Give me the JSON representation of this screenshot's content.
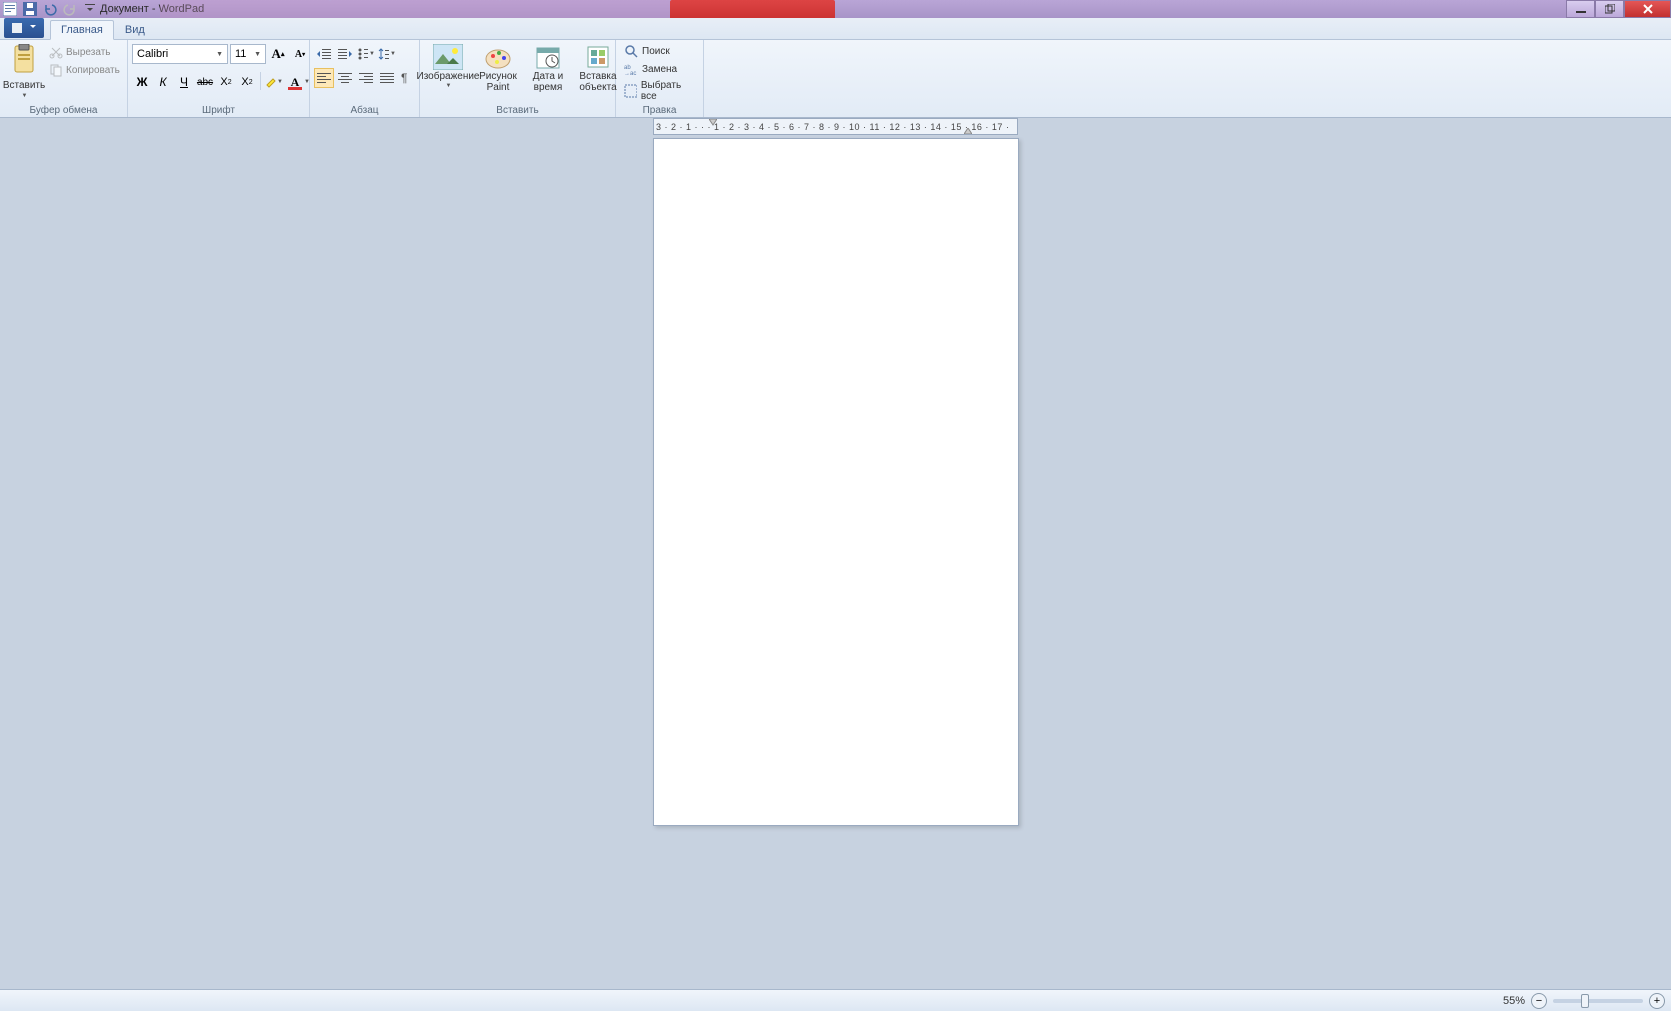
{
  "title": "Документ - WordPad",
  "tabs": {
    "main": "Главная",
    "view": "Вид"
  },
  "clipboard": {
    "paste": "Вставить",
    "cut": "Вырезать",
    "copy": "Копировать",
    "group": "Буфер обмена"
  },
  "font": {
    "family": "Calibri",
    "size": "11",
    "group": "Шрифт",
    "bold": "Ж",
    "italic": "К",
    "underline": "Ч",
    "strike": "abc"
  },
  "paragraph": {
    "group": "Абзац"
  },
  "insert": {
    "image": "Изображение",
    "paint": "Рисунок Paint",
    "datetime": "Дата и время",
    "object": "Вставка объекта",
    "group": "Вставить"
  },
  "edit": {
    "find": "Поиск",
    "replace": "Замена",
    "selectall": "Выбрать все",
    "group": "Правка"
  },
  "ruler": "3 · 2 · 1 · · · 1 · 2 · 3 · 4 · 5 · 6 · 7 · 8 · 9 · 10 · 11 · 12 · 13 · 14 · 15 · 16 · 17 ·",
  "zoom": {
    "pct": "55%"
  }
}
